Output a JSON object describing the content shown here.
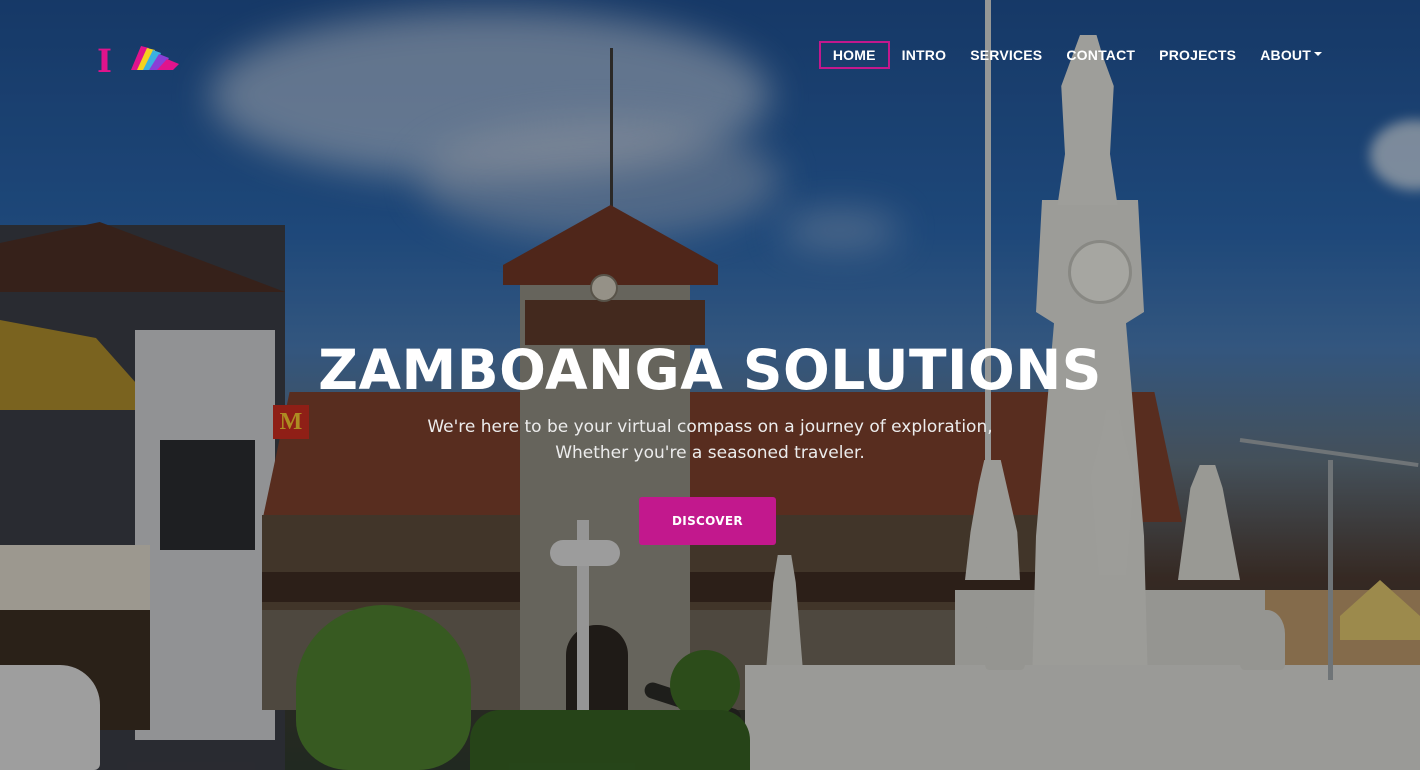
{
  "brand": {
    "logo_letter": "I",
    "logo_colors": [
      "#e0138c",
      "#f4d21f",
      "#3ab0e2",
      "#8a3fd6"
    ]
  },
  "nav": {
    "items": [
      {
        "label": "HOME",
        "active": true
      },
      {
        "label": "INTRO"
      },
      {
        "label": "SERVICES"
      },
      {
        "label": "CONTACT"
      },
      {
        "label": "PROJECTS"
      },
      {
        "label": "ABOUT",
        "has_dropdown": true
      }
    ]
  },
  "hero": {
    "title": "ZAMBOANGA SOLUTIONS",
    "subtitle_line1": "We're here to be your virtual compass on a journey of exploration,",
    "subtitle_line2": "Whether you're a seasoned traveler.",
    "cta_label": "DISCOVER",
    "background_image": "zamboanga-city-hall-and-rizal-monument",
    "mc_sign": "M"
  },
  "colors": {
    "accent": "#c2188d",
    "text": "#ffffff"
  }
}
